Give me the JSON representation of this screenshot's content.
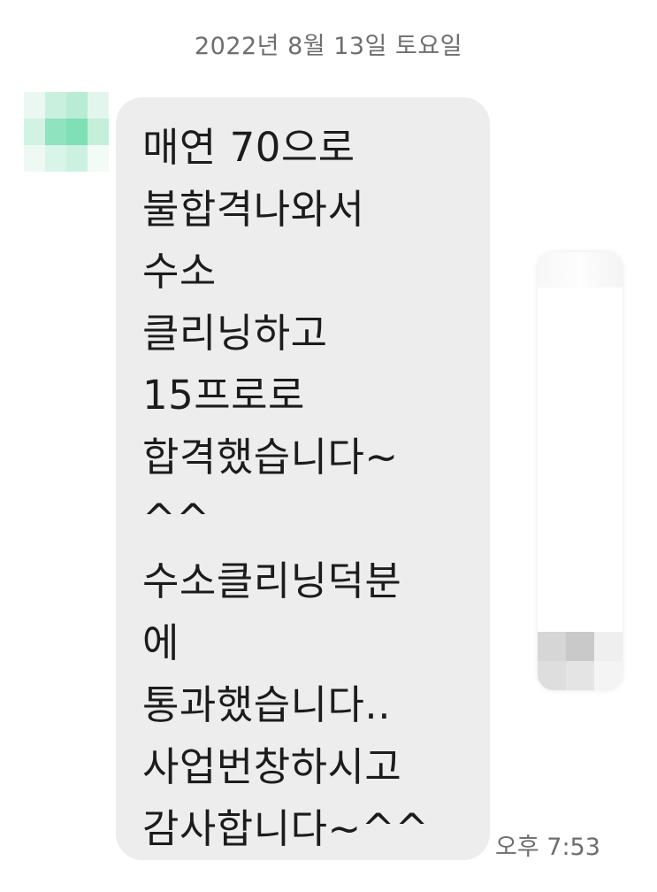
{
  "date_header": "2022년 8월 13일 토요일",
  "message": {
    "lines": [
      "매연 70으로",
      "불합격나와서",
      "수소",
      "클리닝하고",
      "15프로로",
      "합격했습니다~",
      "^^",
      "수소클리닝덕분",
      "에",
      "통과했습니다..",
      "사업번창하시고",
      "감사합니다~^^"
    ],
    "time": "오후 7:53"
  },
  "colors": {
    "bubble_background": "#ededed",
    "text": "#1c1c1c",
    "meta_text": "#6e6e6e",
    "avatar_accent": "#7fe0b6"
  },
  "icons": {
    "sender_avatar": "blurred-avatar"
  }
}
